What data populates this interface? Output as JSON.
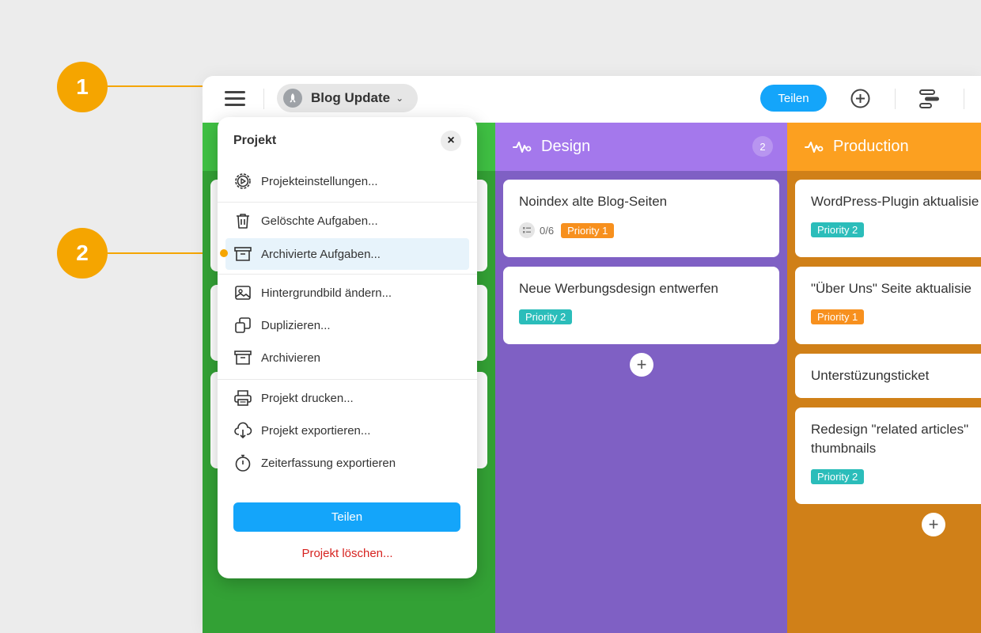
{
  "callouts": [
    "1",
    "2"
  ],
  "topbar": {
    "project_name": "Blog Update",
    "share_label": "Teilen",
    "icons": [
      "menu-icon",
      "rocket-icon",
      "chevron-down-icon",
      "plus-circle-icon",
      "gantt-icon"
    ]
  },
  "colors": {
    "accent_blue": "#14a5fa",
    "callout": "#f5a500",
    "green_column": "#33a135",
    "design_header": "#a478ec",
    "design_body": "#7f60c4",
    "production_header": "#fca020",
    "production_body": "#d08018",
    "priority1": "#f7901e",
    "priority2": "#2bbdba",
    "danger": "#d6221f"
  },
  "columns": [
    {
      "title": "Design",
      "count": "2",
      "cards": [
        {
          "title": "Noindex alte Blog-Seiten",
          "checklist": "0/6",
          "tag": "Priority 1"
        },
        {
          "title": "Neue Werbungsdesign entwerfen",
          "tag": "Priority 2"
        }
      ]
    },
    {
      "title": "Production",
      "cards": [
        {
          "title": "WordPress-Plugin aktualisie",
          "tag": "Priority 2"
        },
        {
          "title": "\"Über Uns\" Seite aktualisie",
          "tag": "Priority 1"
        },
        {
          "title": "Unterstüzungsticket"
        },
        {
          "title": "Redesign \"related articles\" thumbnails",
          "tag": "Priority 2"
        }
      ]
    }
  ],
  "add_label": "+",
  "menu": {
    "title": "Projekt",
    "close": "×",
    "items": [
      {
        "label": "Projekteinstellungen...",
        "icon": "gear-icon"
      },
      {
        "label": "Gelöschte Aufgaben...",
        "icon": "trash-icon"
      },
      {
        "label": "Archivierte Aufgaben...",
        "icon": "archive-icon"
      },
      {
        "label": "Hintergrundbild ändern...",
        "icon": "image-icon"
      },
      {
        "label": "Duplizieren...",
        "icon": "duplicate-icon"
      },
      {
        "label": "Archivieren",
        "icon": "archive-icon"
      },
      {
        "label": "Projekt drucken...",
        "icon": "printer-icon"
      },
      {
        "label": "Projekt exportieren...",
        "icon": "cloud-download-icon"
      },
      {
        "label": "Zeiterfassung exportieren",
        "icon": "stopwatch-icon"
      }
    ],
    "share_label": "Teilen",
    "delete_label": "Projekt löschen..."
  }
}
